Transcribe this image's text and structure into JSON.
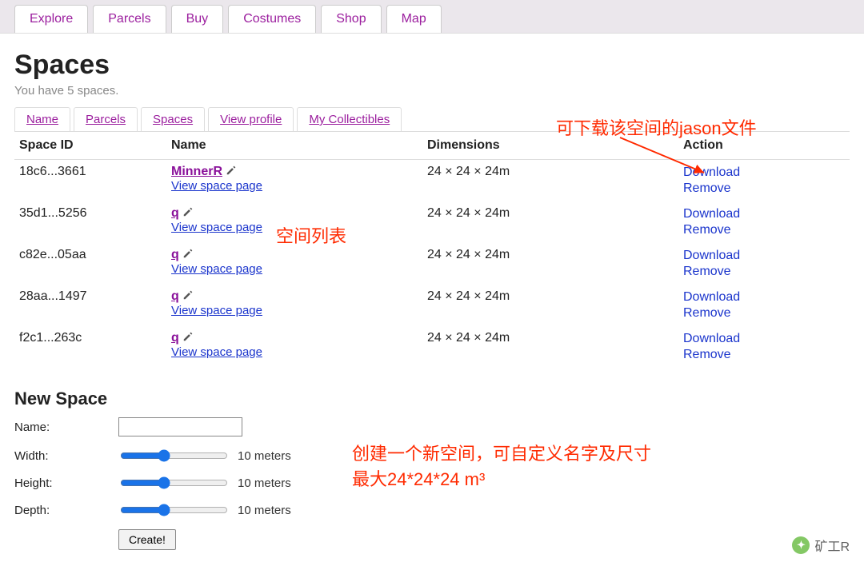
{
  "topnav": {
    "tabs": [
      "Explore",
      "Parcels",
      "Buy",
      "Costumes",
      "Shop",
      "Map"
    ]
  },
  "page": {
    "title": "Spaces",
    "subtitle": "You have 5 spaces."
  },
  "subtabs": [
    "Name",
    "Parcels",
    "Spaces",
    "View profile",
    "My Collectibles"
  ],
  "table": {
    "headers": {
      "id": "Space ID",
      "name": "Name",
      "dim": "Dimensions",
      "action": "Action"
    },
    "view_label": "View space page",
    "action_download": "Download",
    "action_remove": "Remove",
    "rows": [
      {
        "id": "18c6...3661",
        "name": "MinnerR",
        "dim": "24 × 24 × 24m"
      },
      {
        "id": "35d1...5256",
        "name": "q",
        "dim": "24 × 24 × 24m"
      },
      {
        "id": "c82e...05aa",
        "name": "q",
        "dim": "24 × 24 × 24m"
      },
      {
        "id": "28aa...1497",
        "name": "q",
        "dim": "24 × 24 × 24m"
      },
      {
        "id": "f2c1...263c",
        "name": "q",
        "dim": "24 × 24 × 24m"
      }
    ]
  },
  "new_space": {
    "heading": "New Space",
    "name_label": "Name:",
    "name_value": "",
    "width_label": "Width:",
    "height_label": "Height:",
    "depth_label": "Depth:",
    "slider_value": "10",
    "slider_unit": " meters",
    "create_label": "Create!"
  },
  "annotations": {
    "a1": "可下载该空间的jason文件",
    "a2": "空间列表",
    "a3_line1": "创建一个新空间，可自定义名字及尺寸",
    "a3_line2": "最大24*24*24 m³"
  },
  "watermark": {
    "text": "矿工R"
  }
}
